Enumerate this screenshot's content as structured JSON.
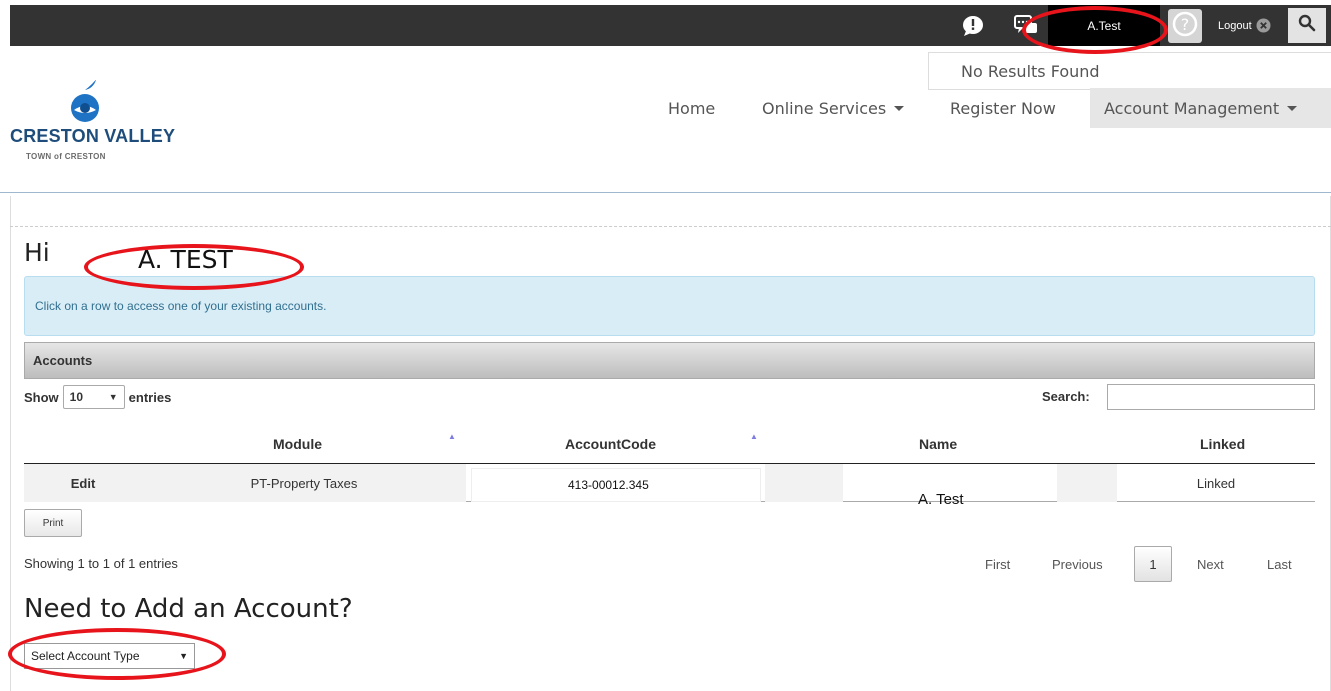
{
  "topbar": {
    "user": "A.Test",
    "logout_label": "Logout"
  },
  "search_results": {
    "message": "No Results Found"
  },
  "logo": {
    "title": "CRESTON VALLEY",
    "subtitle": "TOWN of CRESTON"
  },
  "nav": {
    "home": "Home",
    "online_services": "Online Services",
    "register": "Register Now",
    "account_management": "Account Management"
  },
  "greeting": {
    "hi": "Hi",
    "name": "A. TEST"
  },
  "info": {
    "text": "Click on a row to access one of your existing accounts."
  },
  "accounts": {
    "heading": "Accounts",
    "show_label": "Show",
    "entries_value": "10",
    "entries_label": "entries",
    "search_label": "Search:",
    "columns": {
      "module": "Module",
      "account_code": "AccountCode",
      "name": "Name",
      "linked": "Linked"
    },
    "rows": [
      {
        "action": "Edit",
        "module": "PT-Property Taxes",
        "account_code": "413-00012.345",
        "name": "A. Test",
        "linked": "Linked"
      }
    ],
    "print_label": "Print",
    "showing": "Showing 1 to 1 of 1 entries",
    "pagination": {
      "first": "First",
      "previous": "Previous",
      "current": "1",
      "next": "Next",
      "last": "Last"
    }
  },
  "add_account": {
    "title": "Need to Add an Account?",
    "select_value": "Select Account Type"
  },
  "colors": {
    "annotation": "#e8141b",
    "topbar": "#333333",
    "brand": "#1e4d7b",
    "info_bg": "#d9edf7"
  },
  "icons": [
    "alert-icon",
    "chat-icon",
    "avatar",
    "close-circle-icon",
    "search-icon",
    "sort-asc-icon",
    "caret-down-icon"
  ]
}
